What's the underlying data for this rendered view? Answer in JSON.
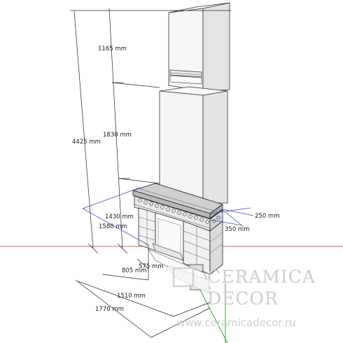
{
  "dimensions": {
    "top_section": "1165 mm",
    "middle_section": "1830 mm",
    "total_height": "4425 mm",
    "mantel_height": "1430 mm",
    "depth_left": "1580 mm",
    "right_projection": "250 mm",
    "right_depth": "350 mm",
    "firebox_width": "575 mm",
    "inner_width": "805 mm",
    "base_width": "1510 mm",
    "overall_width": "1770 mm"
  },
  "watermark": {
    "brand_line1": "CERAMICA",
    "brand_line2": "DECOR",
    "url": "www.ceramicadecor.ru"
  },
  "colors": {
    "axis_red": "#c83232",
    "axis_green": "#2f9a2f",
    "axis_blue": "#3a4fd0",
    "model_fill": "#f4f4f4",
    "model_shade": "#d9d9d9"
  }
}
